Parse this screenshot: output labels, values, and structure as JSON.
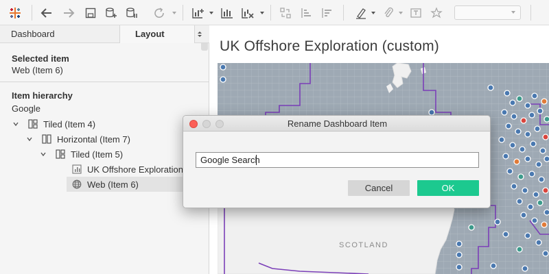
{
  "toolbar": {
    "buttons": [
      {
        "icon": "tableau-logo-icon"
      },
      {
        "icon": "back-arrow-icon"
      },
      {
        "icon": "forward-arrow-icon"
      },
      {
        "icon": "save-icon"
      },
      {
        "icon": "new-data-source-icon"
      },
      {
        "icon": "pause-updates-icon"
      },
      {
        "icon": "refresh-icon"
      },
      {
        "icon": "new-worksheet-icon"
      },
      {
        "icon": "duplicate-sheet-icon"
      },
      {
        "icon": "clear-sheet-icon"
      },
      {
        "icon": "swap-icon"
      },
      {
        "icon": "sort-ascending-icon"
      },
      {
        "icon": "sort-descending-icon"
      },
      {
        "icon": "highlight-icon"
      },
      {
        "icon": "group-icon"
      },
      {
        "icon": "show-labels-icon"
      },
      {
        "icon": "pin-icon"
      }
    ],
    "fit_select_value": ""
  },
  "left_panel": {
    "tabs": [
      {
        "label": "Dashboard",
        "active": false
      },
      {
        "label": "Layout",
        "active": true
      }
    ],
    "selected_item": {
      "title": "Selected item",
      "value": "Web (Item 6)"
    },
    "hierarchy": {
      "title": "Item hierarchy",
      "root": "Google",
      "items": [
        {
          "label": "Tiled (Item 4)",
          "icon": "tiled-container-icon",
          "expanded": true
        },
        {
          "label": "Horizontal (Item 7)",
          "icon": "horizontal-container-icon",
          "expanded": true
        },
        {
          "label": "Tiled (Item 5)",
          "icon": "tiled-container-icon",
          "expanded": true
        },
        {
          "label": "UK Offshore Exploration",
          "icon": "worksheet-icon",
          "expanded": null
        },
        {
          "label": "Web (Item 6)",
          "icon": "globe-icon",
          "expanded": null,
          "selected": true
        }
      ]
    }
  },
  "main": {
    "title": "UK Offshore Exploration (custom)",
    "map": {
      "place_label": "SCOTLAND",
      "colors": {
        "sea": "#9ea9b4",
        "land": "#f0f0f0",
        "grid": "#b7c0c8",
        "boundary": "#7b3fb8",
        "point_blue": "#4a79b0",
        "point_teal": "#3d9b8c",
        "point_orange": "#e07b39",
        "point_red": "#d9453d"
      }
    }
  },
  "dialog": {
    "title": "Rename Dashboard Item",
    "input_value": "Google Search",
    "cancel_label": "Cancel",
    "ok_label": "OK",
    "colors": {
      "ok": "#1cc98f",
      "close_light": "#fc5f57"
    }
  }
}
